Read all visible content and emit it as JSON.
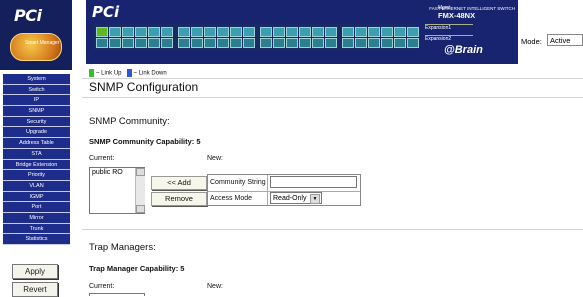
{
  "sidebar": {
    "logo": "PCi",
    "badge_text": "Smart Manager",
    "items": [
      "System",
      "Switch",
      "IP",
      "SNMP",
      "Security",
      "Upgrade",
      "Address Table",
      "STA",
      "Bridge Extension",
      "Priority",
      "VLAN",
      "IGMP",
      "Port",
      "Mirror",
      "Trunk",
      "Statistics"
    ],
    "apply_label": "Apply",
    "revert_label": "Revert"
  },
  "header": {
    "logo": "PCi",
    "model_tagline": "FAST ETHERNET INTELLIGENT SWITCH",
    "mgmt": "Mgmt",
    "model": "FMX-48NX",
    "expansion1": "Expansion1",
    "expansion2": "Expansion2",
    "brand": "@Brain",
    "mode_label": "Mode:",
    "mode_value": "Active"
  },
  "legend": {
    "link_up": "~ Link Up",
    "link_down": "~ Link Down",
    "link_up_color": "#34c028",
    "link_down_color": "#2e58d8"
  },
  "page": {
    "title": "SNMP Configuration"
  },
  "community": {
    "heading": "SNMP Community:",
    "capability": "SNMP Community Capability: 5",
    "current_label": "Current:",
    "new_label": "New:",
    "current_items": [
      "public RO"
    ],
    "add_label": "<< Add",
    "remove_label": "Remove",
    "community_string_label": "Community String",
    "community_string_value": "",
    "access_mode_label": "Access Mode",
    "access_mode_value": "Read-Only"
  },
  "trap": {
    "heading": "Trap Managers:",
    "capability": "Trap Manager Capability: 5",
    "current_label": "Current:",
    "new_label": "New:"
  }
}
